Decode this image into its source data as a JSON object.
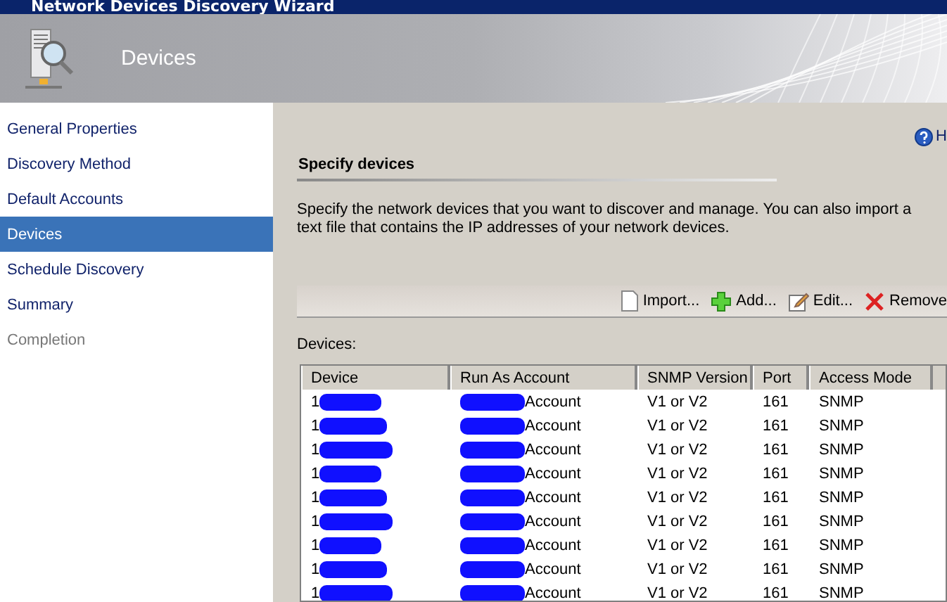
{
  "window": {
    "title": "Network Devices Discovery Wizard"
  },
  "header": {
    "title": "Devices"
  },
  "sidebar": {
    "items": [
      {
        "label": "General Properties",
        "selected": false,
        "disabled": false
      },
      {
        "label": "Discovery Method",
        "selected": false,
        "disabled": false
      },
      {
        "label": "Default Accounts",
        "selected": false,
        "disabled": false
      },
      {
        "label": "Devices",
        "selected": true,
        "disabled": false
      },
      {
        "label": "Schedule Discovery",
        "selected": false,
        "disabled": false
      },
      {
        "label": "Summary",
        "selected": false,
        "disabled": false
      },
      {
        "label": "Completion",
        "selected": false,
        "disabled": true
      }
    ]
  },
  "help": {
    "label": "H"
  },
  "section": {
    "title": "Specify devices",
    "description": "Specify the network devices that you want to discover and manage. You can also import a text file that contains the IP addresses of your network devices."
  },
  "toolbar": [
    {
      "kind": "import",
      "label": "Import..."
    },
    {
      "kind": "add",
      "label": "Add..."
    },
    {
      "kind": "edit",
      "label": "Edit..."
    },
    {
      "kind": "remove",
      "label": "Remove"
    }
  ],
  "table": {
    "label": "Devices:",
    "columns": [
      "Device",
      "Run As Account",
      "SNMP Version",
      "Port",
      "Access Mode"
    ],
    "rows": [
      [
        "1",
        "Account",
        "V1 or V2",
        "161",
        "SNMP"
      ],
      [
        "1",
        "Account",
        "V1 or V2",
        "161",
        "SNMP"
      ],
      [
        "1",
        "Account",
        "V1 or V2",
        "161",
        "SNMP"
      ],
      [
        "1",
        "Account",
        "V1 or V2",
        "161",
        "SNMP"
      ],
      [
        "1",
        "Account",
        "V1 or V2",
        "161",
        "SNMP"
      ],
      [
        "1",
        "Account",
        "V1 or V2",
        "161",
        "SNMP"
      ],
      [
        "1",
        "Account",
        "V1 or V2",
        "161",
        "SNMP"
      ],
      [
        "1",
        "Account",
        "V1 or V2",
        "161",
        "SNMP"
      ],
      [
        "1",
        "Account",
        "V1 or V2",
        "161",
        "SNMP"
      ]
    ]
  }
}
